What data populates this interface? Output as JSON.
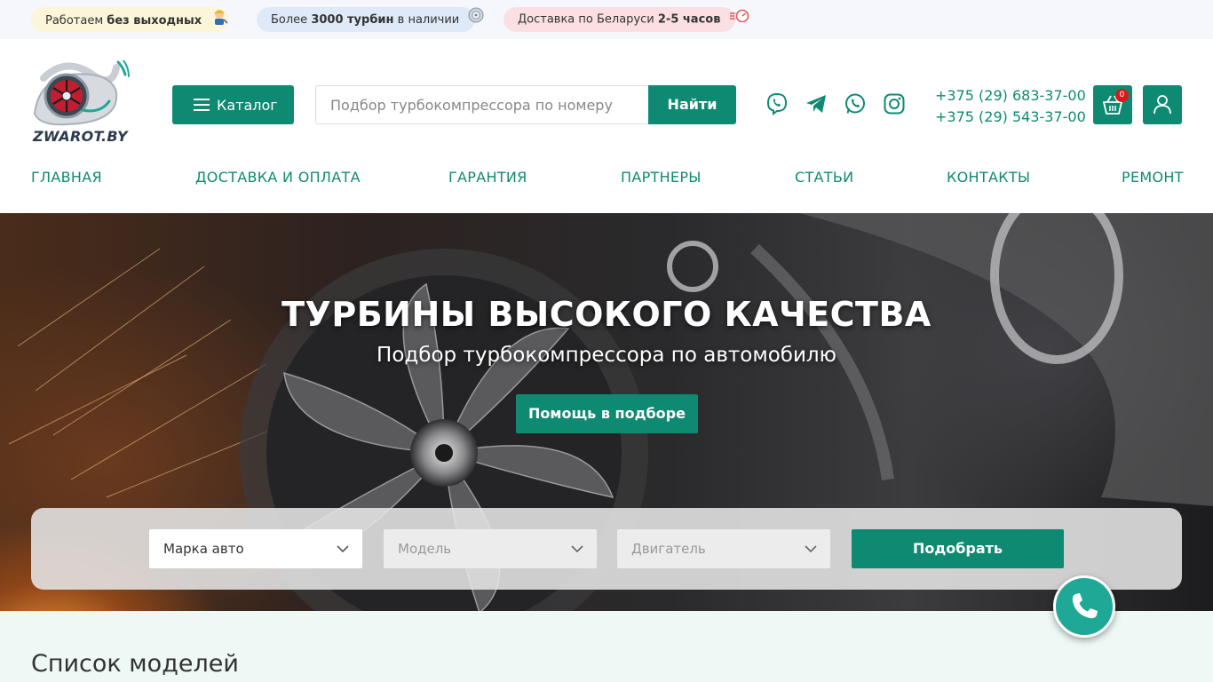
{
  "topbar": {
    "pill1": {
      "text": "Работаем ",
      "bold": "без выходных",
      "icon": "worker-icon"
    },
    "pill2": {
      "text": "Более ",
      "bold": "3000 турбин",
      "tail": " в наличии",
      "icon": "turbine-icon"
    },
    "pill3": {
      "text": "Доставка по Беларуси ",
      "bold": "2-5 часов",
      "icon": "speedometer-icon"
    }
  },
  "header": {
    "logo_text": "ZWAROT.BY",
    "catalog_label": "Каталог",
    "search_placeholder": "Подбор турбокомпрессора по номеру",
    "search_button": "Найти",
    "phones": [
      "+375 (29) 683-37-00",
      "+375 (29) 543-37-00"
    ],
    "cart_count": "0",
    "social_icons": [
      "viber-icon",
      "telegram-icon",
      "whatsapp-icon",
      "instagram-icon"
    ]
  },
  "nav": [
    "ГЛАВНАЯ",
    "ДОСТАВКА И ОПЛАТА",
    "ГАРАНТИЯ",
    "ПАРТНЕРЫ",
    "СТАТЬИ",
    "КОНТАКТЫ",
    "РЕМОНТ"
  ],
  "hero": {
    "title": "ТУРБИНЫ ВЫСОКОГО КАЧЕСТВА",
    "subtitle": "Подбор турбокомпрессора по автомобилю",
    "help_button": "Помощь в подборе"
  },
  "picker": {
    "brand": "Марка авто",
    "model": "Модель",
    "engine": "Двигатель",
    "submit": "Подобрать"
  },
  "section": {
    "title": "Список моделей"
  },
  "colors": {
    "accent": "#0f8a72",
    "call": "#1fa896",
    "badge": "#d41b1b"
  }
}
